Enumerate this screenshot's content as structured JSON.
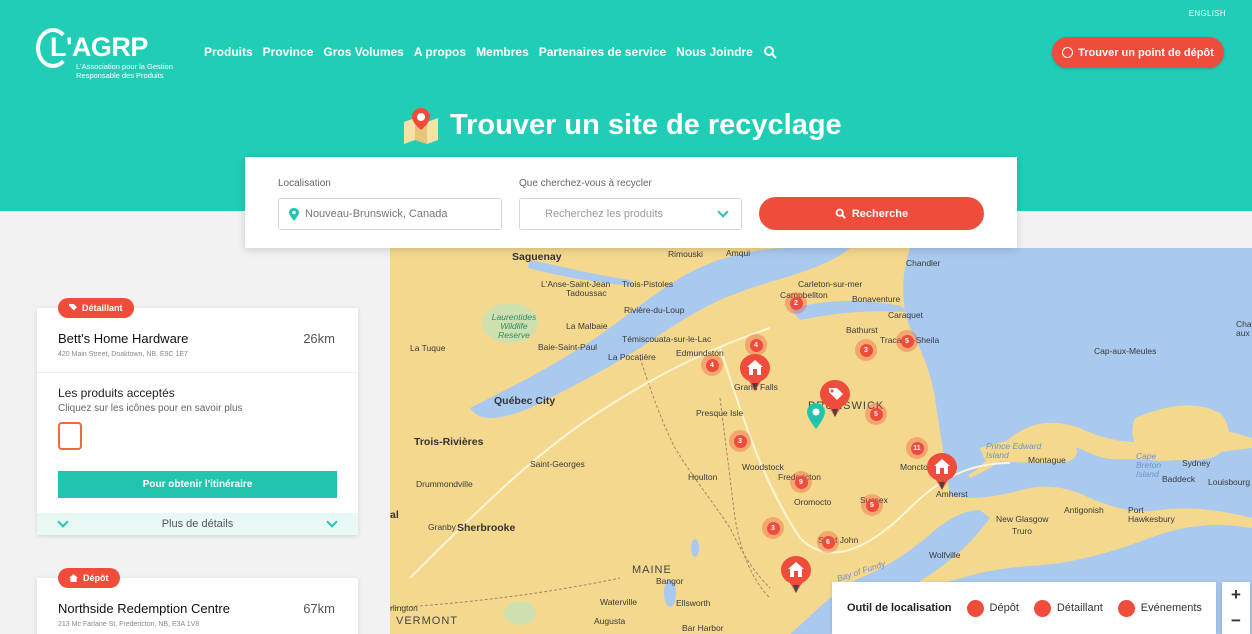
{
  "header": {
    "language_link": "ENGLISH",
    "logo_text": "L'AGRP",
    "logo_subtitle": "L'Association pour la Gestion Responsable des Produits",
    "nav": [
      "Produits",
      "Province",
      "Gros Volumes",
      "A propos",
      "Membres",
      "Partenaires de service",
      "Nous Joindre"
    ],
    "cta": "Trouver un point de dépôt",
    "page_title": "Trouver un site de recyclage"
  },
  "search": {
    "location_label": "Localisation",
    "location_value": "Nouveau-Brunswick, Canada",
    "product_label": "Que cherchez-vous à recycler",
    "product_placeholder": "Recherchez les produits",
    "button": "Recherche"
  },
  "results": [
    {
      "badge": "Détaillant",
      "name": "Bett's Home Hardware",
      "distance": "26km",
      "address": "420 Main Street, Doaktown, NB, E9C 1E7",
      "products_heading": "Les produits acceptés",
      "products_hint": "Cliquez sur les icônes pour en savoir plus",
      "directions": "Pour obtenir l'itinéraire",
      "more": "Plus de détails"
    },
    {
      "badge": "Dépôt",
      "name": "Northside Redemption Centre",
      "distance": "67km",
      "address": "213 Mc Farlane St, Fredericton, NB, E3A 1V8"
    }
  ],
  "map": {
    "labels": {
      "saguenay": "Saguenay",
      "rimouski": "Rimouski",
      "amqui": "Amqui",
      "chandler": "Chandler",
      "lanse": "L'Anse-Saint-Jean",
      "trois_pistoles": "Trois-Pistoles",
      "tadoussac": "Tadoussac",
      "carleton": "Carleton-sur-mer",
      "campbellton": "Campbellton",
      "bonaventure": "Bonaventure",
      "riviere": "Rivière-du-Loup",
      "laurentides": "Laurentides Wildlife Reserve",
      "malbaie": "La Malbaie",
      "caraquet": "Caraquet",
      "bathurst": "Bathurst",
      "tracadie": "Tracadie-Sheila",
      "temiscouata": "Témiscouata-sur-le-Lac",
      "la_tuque": "La Tuque",
      "baie_st_paul": "Baie-Saint-Paul",
      "edmundston": "Edmundston",
      "la_pocatiere": "La Pocatière",
      "cap_aux_meules": "Cap-aux-Meules",
      "grand_falls": "Grand Falls",
      "quebec": "Québec City",
      "presque_isle": "Presque Isle",
      "nb": "BRUNSWICK",
      "trois_rivieres": "Trois-Rivières",
      "pei": "Prince Edward Island",
      "montague": "Montague",
      "saint_georges": "Saint-Georges",
      "moncton": "Moncton",
      "woodstock": "Woodstock",
      "houlton": "Houlton",
      "fredericton": "Fredericton",
      "drummondville": "Drummondville",
      "oromocto": "Oromocto",
      "sussex": "Sussex",
      "amherst": "Amherst",
      "cape_breton": "Cape Breton Island",
      "sydney": "Sydney",
      "baddeck": "Baddeck",
      "louisbourg": "Louisbourg",
      "granby": "Granby",
      "sherbrooke": "Sherbrooke",
      "saint_john": "Saint John",
      "new_glasgow": "New Glasgow",
      "antigonish": "Antigonish",
      "port_hawkesbury": "Port Hawkesbury",
      "truro": "Truro",
      "maine": "MAINE",
      "bangor": "Bangor",
      "wolfville": "Wolfville",
      "bay_of_fundy": "Bay of Fundy",
      "waterville": "Waterville",
      "ellsworth": "Ellsworth",
      "vermont": "VERMONT",
      "augusta": "Augusta",
      "bar_harbor": "Bar Harbor",
      "burlington": "rlington",
      "cha": "Cha aux",
      "al": "al"
    },
    "clusters": [
      {
        "id": "c1",
        "count": "2"
      },
      {
        "id": "c2",
        "count": "4"
      },
      {
        "id": "c3",
        "count": "4"
      },
      {
        "id": "c4",
        "count": "3"
      },
      {
        "id": "c5",
        "count": "5"
      },
      {
        "id": "c6",
        "count": "5"
      },
      {
        "id": "c7",
        "count": "3"
      },
      {
        "id": "c8",
        "count": "11"
      },
      {
        "id": "c9",
        "count": "9"
      },
      {
        "id": "c10",
        "count": "5"
      },
      {
        "id": "c11",
        "count": "3"
      },
      {
        "id": "c12",
        "count": "6"
      }
    ],
    "legend": {
      "title": "Outil de localisation",
      "items": [
        "Dépôt",
        "Détaillant",
        "Evénements"
      ]
    },
    "zoom_in": "+",
    "zoom_out": "−"
  },
  "colors": {
    "teal": "#22cdb6",
    "red": "#ef4c3b",
    "land": "#f4d88e",
    "water": "#a9c9ee"
  }
}
